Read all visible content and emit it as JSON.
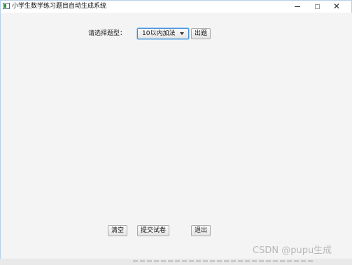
{
  "window": {
    "title": "小学生数学练习题目自动生成系统",
    "controls": {
      "minimize": "—",
      "maximize": "□",
      "close": "✕"
    }
  },
  "form": {
    "type_label": "请选择题型：",
    "type_select": {
      "value": "10以内加法"
    },
    "generate_button": "出题"
  },
  "actions": {
    "clear": "清空",
    "submit": "提交试卷",
    "exit": "退出"
  },
  "watermark": "CSDN @pupu生成"
}
